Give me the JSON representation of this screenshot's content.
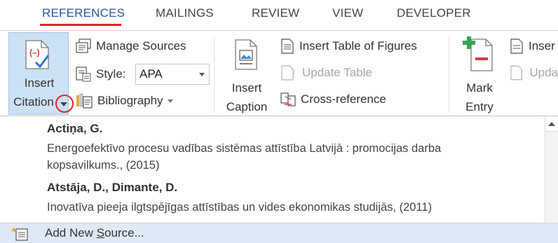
{
  "tabs": [
    {
      "label": "REFERENCES",
      "active": true
    },
    {
      "label": "MAILINGS"
    },
    {
      "label": "REVIEW"
    },
    {
      "label": "VIEW"
    },
    {
      "label": "DEVELOPER"
    }
  ],
  "ribbon": {
    "insert_citation": {
      "line1": "Insert",
      "line2": "Citation"
    },
    "manage_sources": "Manage Sources",
    "style_label": "Style:",
    "style_value": "APA",
    "bibliography": "Bibliography",
    "insert_caption": {
      "line1": "Insert",
      "line2": "Caption"
    },
    "insert_table_of_figures": "Insert Table of Figures",
    "update_table": "Update Table",
    "cross_reference": "Cross-reference",
    "mark_entry": {
      "line1": "Mark",
      "line2": "Entry"
    },
    "insert_cut": "Inser",
    "update_cut": "Upda"
  },
  "sources": [
    {
      "author": "Actiņa, G.",
      "title_line1": "Energoefektīvo procesu vadības sistēmas attīstība Latvijā : promocijas darba",
      "title_line2": "kopsavilkums., (2015)"
    },
    {
      "author": "Atstāja, D., Dimante, D.",
      "title_line1": "Inovatīva pieeja ilgtspējīgas attīstības un vides ekonomikas studijās, (2011)"
    }
  ],
  "add_new_source": {
    "before": "Add New ",
    "underlined": "S",
    "after": "ource..."
  },
  "colors": {
    "accent": "#2b579a",
    "highlight_red": "#e0242a",
    "selected": "#cde1f5",
    "hover_row": "#dfe9f5"
  }
}
